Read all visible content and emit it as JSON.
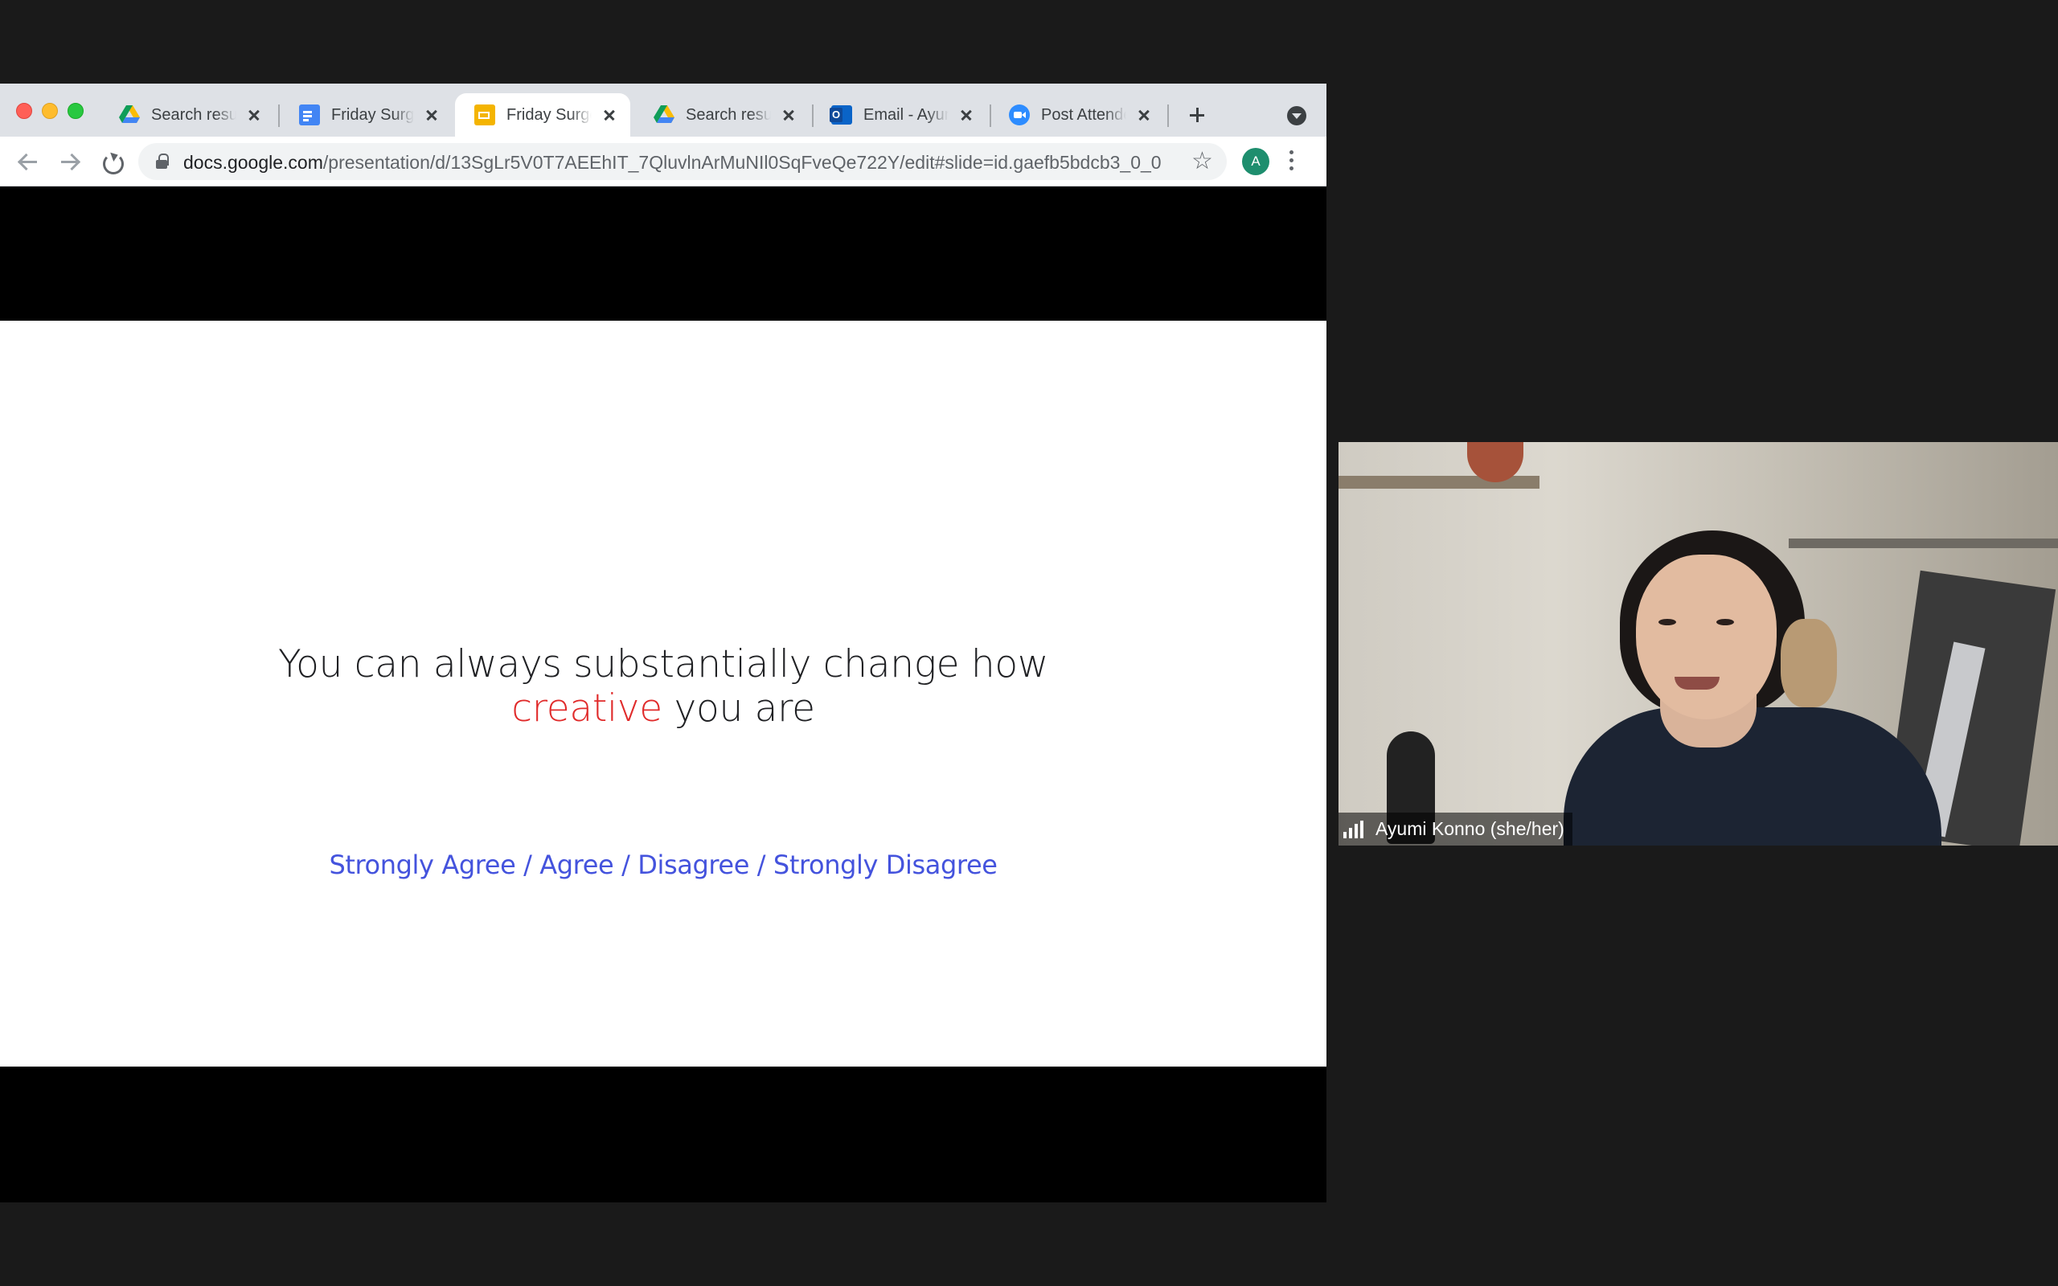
{
  "browser": {
    "tabs": [
      {
        "title": "Search results",
        "icon": "google-drive-icon",
        "active": false
      },
      {
        "title": "Friday Surge",
        "icon": "google-docs-icon",
        "active": false
      },
      {
        "title": "Friday Surge",
        "icon": "google-slides-icon",
        "active": true
      },
      {
        "title": "Search results",
        "icon": "google-drive-icon",
        "active": false
      },
      {
        "title": "Email - Ayumi",
        "icon": "outlook-icon",
        "active": false
      },
      {
        "title": "Post Attendee",
        "icon": "zoom-icon",
        "active": false
      }
    ],
    "url": {
      "host": "docs.google.com",
      "path": "/presentation/d/13SgLr5V0T7AEEhIT_7QluvlnArMuNIl0SqFveQe722Y/edit#slide=id.gaefb5bdcb3_0_0"
    },
    "profile_initial": "A"
  },
  "slide": {
    "statement_line1": "You can always substantially change how",
    "statement_highlight": "creative",
    "statement_rest": " you are",
    "options": "Strongly Agree / Agree / Disagree / Strongly Disagree",
    "colors": {
      "highlight": "#e02b2b",
      "options": "#4453dd"
    }
  },
  "participant": {
    "name": "Ayumi Konno (she/her)",
    "icon": "signal-strength-icon"
  }
}
